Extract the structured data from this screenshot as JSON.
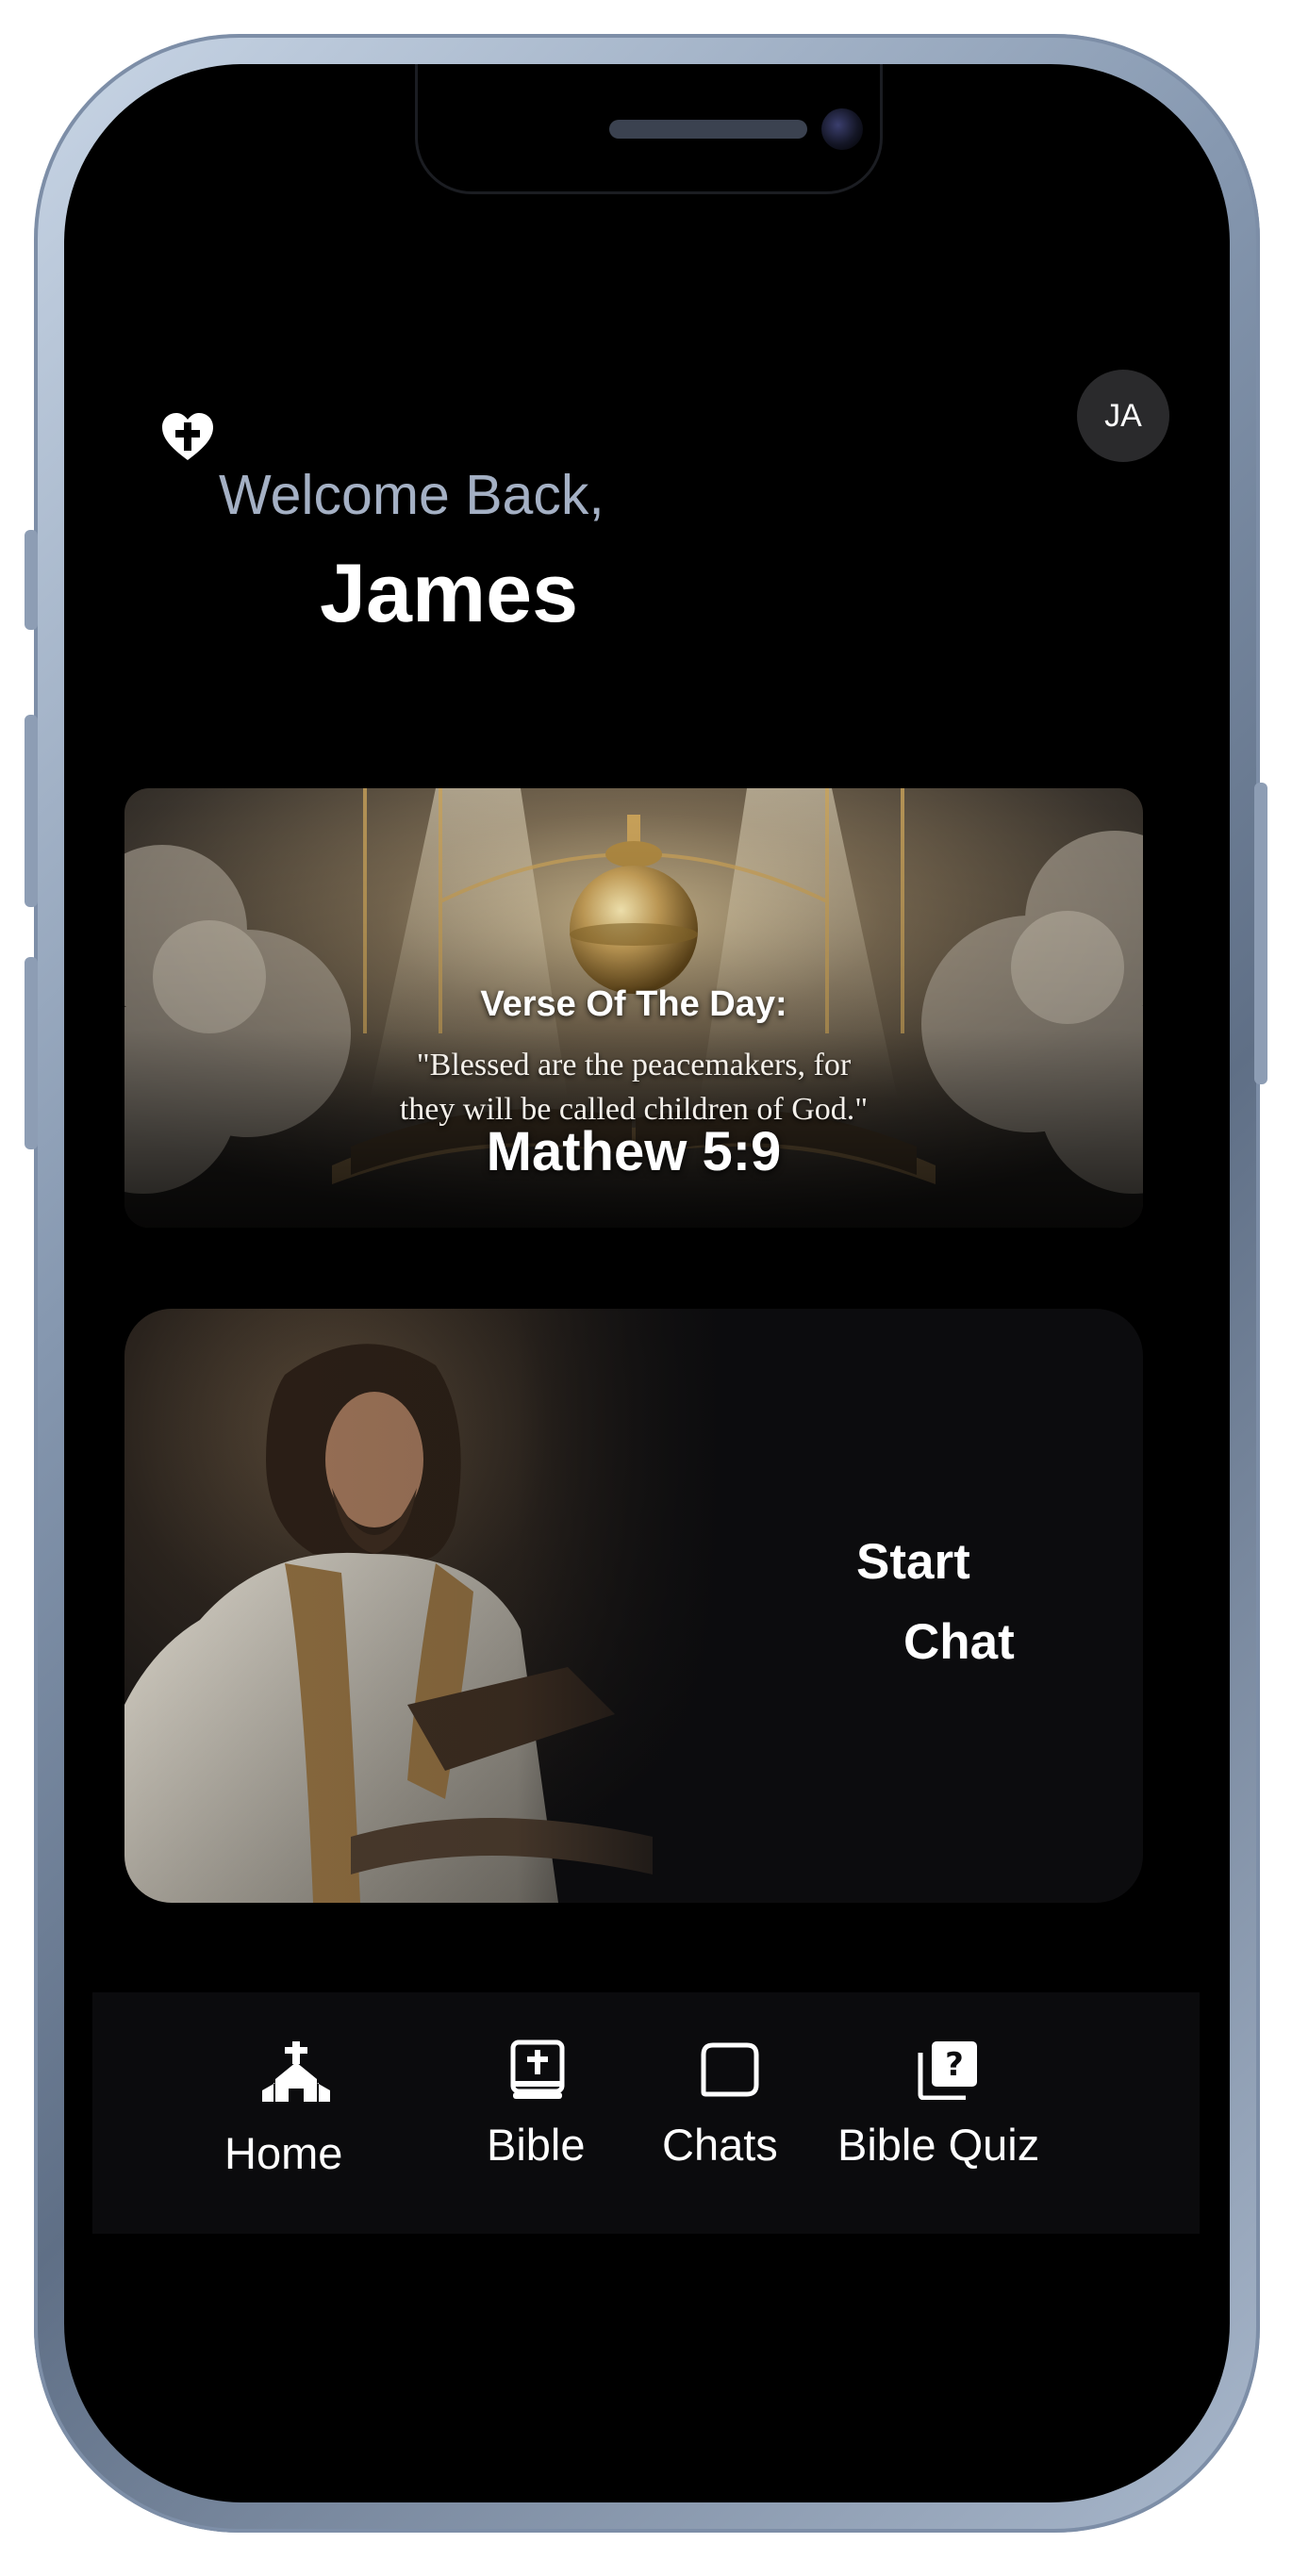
{
  "header": {
    "greeting": "Welcome Back,",
    "user_name": "James",
    "avatar_initials": "JA",
    "brand_icon": "heart-cross-icon"
  },
  "verse_of_day": {
    "title": "Verse Of The Day:",
    "text_line1": "\"Blessed are the peacemakers, for",
    "text_line2": "they will be called children of God.\"",
    "reference": "Mathew 5:9"
  },
  "chat_card": {
    "line1": "Start",
    "line2": "Chat"
  },
  "tab_bar": {
    "items": [
      {
        "label": "Home",
        "icon": "church-icon"
      },
      {
        "label": "Bible",
        "icon": "bible-book-icon"
      },
      {
        "label": "Chats",
        "icon": "chat-bubble-icon"
      },
      {
        "label": "Bible Quiz",
        "icon": "quiz-cards-icon"
      }
    ]
  },
  "colors": {
    "background": "#000000",
    "greeting": "#a4b0c4",
    "text": "#ffffff",
    "tab_bar": "#0b0b0d",
    "avatar": "#2a2a2c",
    "gold_accent": "#c9a25a"
  }
}
